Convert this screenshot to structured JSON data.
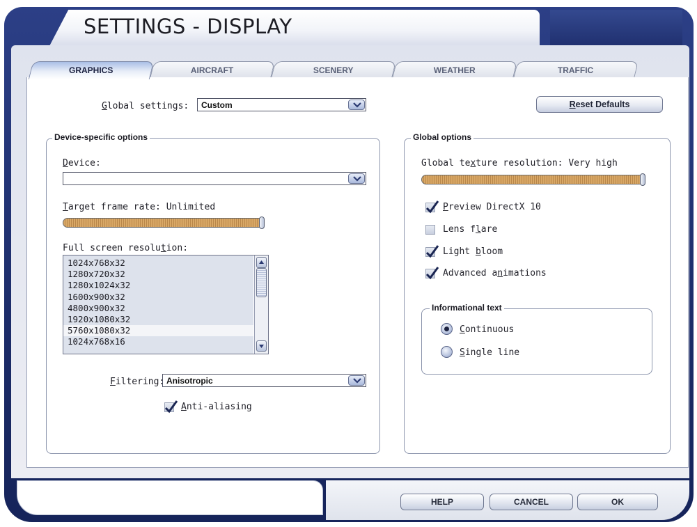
{
  "window": {
    "title": "SETTINGS - DISPLAY"
  },
  "tabs": [
    {
      "label": "GRAPHICS",
      "active": true
    },
    {
      "label": "AIRCRAFT",
      "active": false
    },
    {
      "label": "SCENERY",
      "active": false
    },
    {
      "label": "WEATHER",
      "active": false
    },
    {
      "label": "TRAFFIC",
      "active": false
    }
  ],
  "global_settings": {
    "label_prefix": "",
    "label_u": "G",
    "label_rest": "lobal settings:",
    "value": "Custom"
  },
  "reset_button": {
    "u": "R",
    "rest": "eset Defaults"
  },
  "device_group": {
    "title": "Device-specific options",
    "device_label_u": "D",
    "device_label_rest": "evice:",
    "device_value": "",
    "frame_rate_label_u": "T",
    "frame_rate_label_rest": "arget frame rate: Unlimited",
    "frame_rate_level": 1.0,
    "resolution_label_a": "Full screen resolu",
    "resolution_label_u": "t",
    "resolution_label_b": "ion:",
    "resolutions": [
      "1024x768x32",
      "1280x720x32",
      "1280x1024x32",
      "1600x900x32",
      "4800x900x32",
      "1920x1080x32",
      "5760x1080x32",
      "1024x768x16"
    ],
    "selected_resolution": "5760x1080x32",
    "filtering_label_u": "F",
    "filtering_label_rest": "iltering:",
    "filtering_value": "Anisotropic",
    "anti_aliasing_u": "A",
    "anti_aliasing_rest": "nti-aliasing",
    "anti_aliasing_checked": true
  },
  "global_group": {
    "title": "Global options",
    "texture_label_a": "Global te",
    "texture_label_u": "x",
    "texture_label_b": "ture resolution: Very high",
    "texture_level": 1.0,
    "checkboxes": [
      {
        "pre": "",
        "u": "P",
        "post": "review DirectX 10",
        "checked": true
      },
      {
        "pre": "Lens f",
        "u": "l",
        "post": "are",
        "checked": false
      },
      {
        "pre": "Light ",
        "u": "b",
        "post": "loom",
        "checked": true
      },
      {
        "pre": "Advanced a",
        "u": "n",
        "post": "imations",
        "checked": true
      }
    ]
  },
  "info_group": {
    "title": "Informational text",
    "options": [
      {
        "u": "C",
        "rest": "ontinuous",
        "selected": true
      },
      {
        "u": "S",
        "rest": "ingle line",
        "selected": false
      }
    ]
  },
  "footer": {
    "help": "HELP",
    "cancel": "CANCEL",
    "ok": "OK"
  },
  "colors": {
    "frame": "#1c2c69",
    "panel": "#e4e7f0",
    "slider": "#d9a866"
  }
}
